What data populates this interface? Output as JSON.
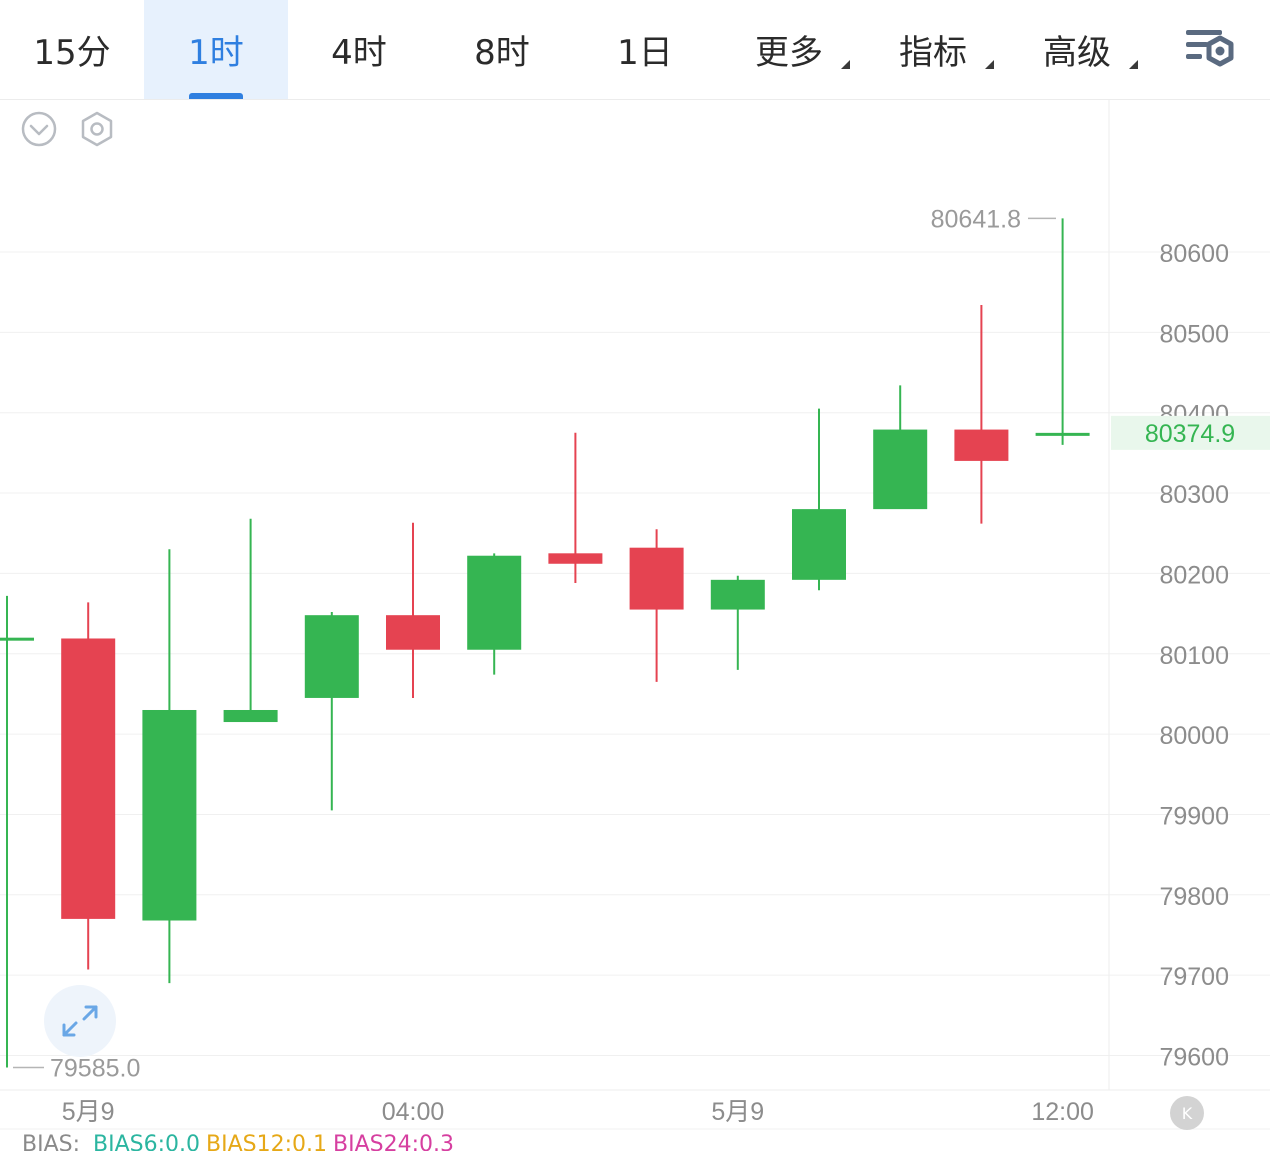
{
  "tabs": [
    {
      "label": "15分",
      "active": false,
      "dropdown": false
    },
    {
      "label": "1时",
      "active": true,
      "dropdown": false
    },
    {
      "label": "4时",
      "active": false,
      "dropdown": false
    },
    {
      "label": "8时",
      "active": false,
      "dropdown": false
    },
    {
      "label": "1日",
      "active": false,
      "dropdown": false
    },
    {
      "label": "更多",
      "active": false,
      "dropdown": true
    },
    {
      "label": "指标",
      "active": false,
      "dropdown": true
    },
    {
      "label": "高级",
      "active": false,
      "dropdown": true
    }
  ],
  "icons": {
    "settings": "chart-settings-icon",
    "collapse": "chevron-down-circle-icon",
    "hexagon": "hexagon-settings-icon",
    "expand": "expand-arrows-icon",
    "k": "k-back-icon"
  },
  "k_button_label": "K",
  "colors": {
    "up": "#35b552",
    "down": "#e54351",
    "accent": "#2f7fe0",
    "grid": "#f0f0f0"
  },
  "chart_data": {
    "type": "candlestick",
    "interval": "1时",
    "y_axis": {
      "min": 79560,
      "max": 80680,
      "ticks": [
        80600,
        80500,
        80400,
        80300,
        80200,
        80100,
        80000,
        79900,
        79800,
        79700,
        79600
      ],
      "side": "right"
    },
    "x_axis_labels": [
      {
        "label": "5月9",
        "index": 1
      },
      {
        "label": "04:00",
        "index": 5
      },
      {
        "label": "5月9",
        "index": 9
      },
      {
        "label": "12:00",
        "index": 13
      }
    ],
    "candles": [
      {
        "open": 80118,
        "high": 80172,
        "low": 79585,
        "close": 80120
      },
      {
        "open": 80119,
        "high": 80164,
        "low": 79707,
        "close": 79770
      },
      {
        "open": 79768,
        "high": 80230,
        "low": 79690,
        "close": 80030
      },
      {
        "open": 80015,
        "high": 80268,
        "low": 80025,
        "close": 80030
      },
      {
        "open": 80045,
        "high": 80152,
        "low": 79905,
        "close": 80148
      },
      {
        "open": 80148,
        "high": 80263,
        "low": 80045,
        "close": 80105
      },
      {
        "open": 80105,
        "high": 80225,
        "low": 80074,
        "close": 80222
      },
      {
        "open": 80225,
        "high": 80375,
        "low": 80188,
        "close": 80212
      },
      {
        "open": 80232,
        "high": 80255,
        "low": 80065,
        "close": 80155
      },
      {
        "open": 80155,
        "high": 80197,
        "low": 80080,
        "close": 80192
      },
      {
        "open": 80192,
        "high": 80405,
        "low": 80179,
        "close": 80280
      },
      {
        "open": 80280,
        "high": 80434,
        "low": 80282,
        "close": 80379
      },
      {
        "open": 80379,
        "high": 80534,
        "low": 80262,
        "close": 80340
      },
      {
        "open": 80373,
        "high": 80641.8,
        "low": 80360,
        "close": 80374.9
      }
    ],
    "high_label": "80641.8",
    "low_label": "79585.0",
    "current_price": "80374.9",
    "indicator": {
      "name": "BIAS:",
      "items": [
        {
          "label": "BIAS6:0.0",
          "color": "#2bb5a0"
        },
        {
          "label": "BIAS12:0.1",
          "color": "#e6a817"
        },
        {
          "label": "BIAS24:0.3",
          "color": "#d63fa0"
        }
      ]
    }
  }
}
